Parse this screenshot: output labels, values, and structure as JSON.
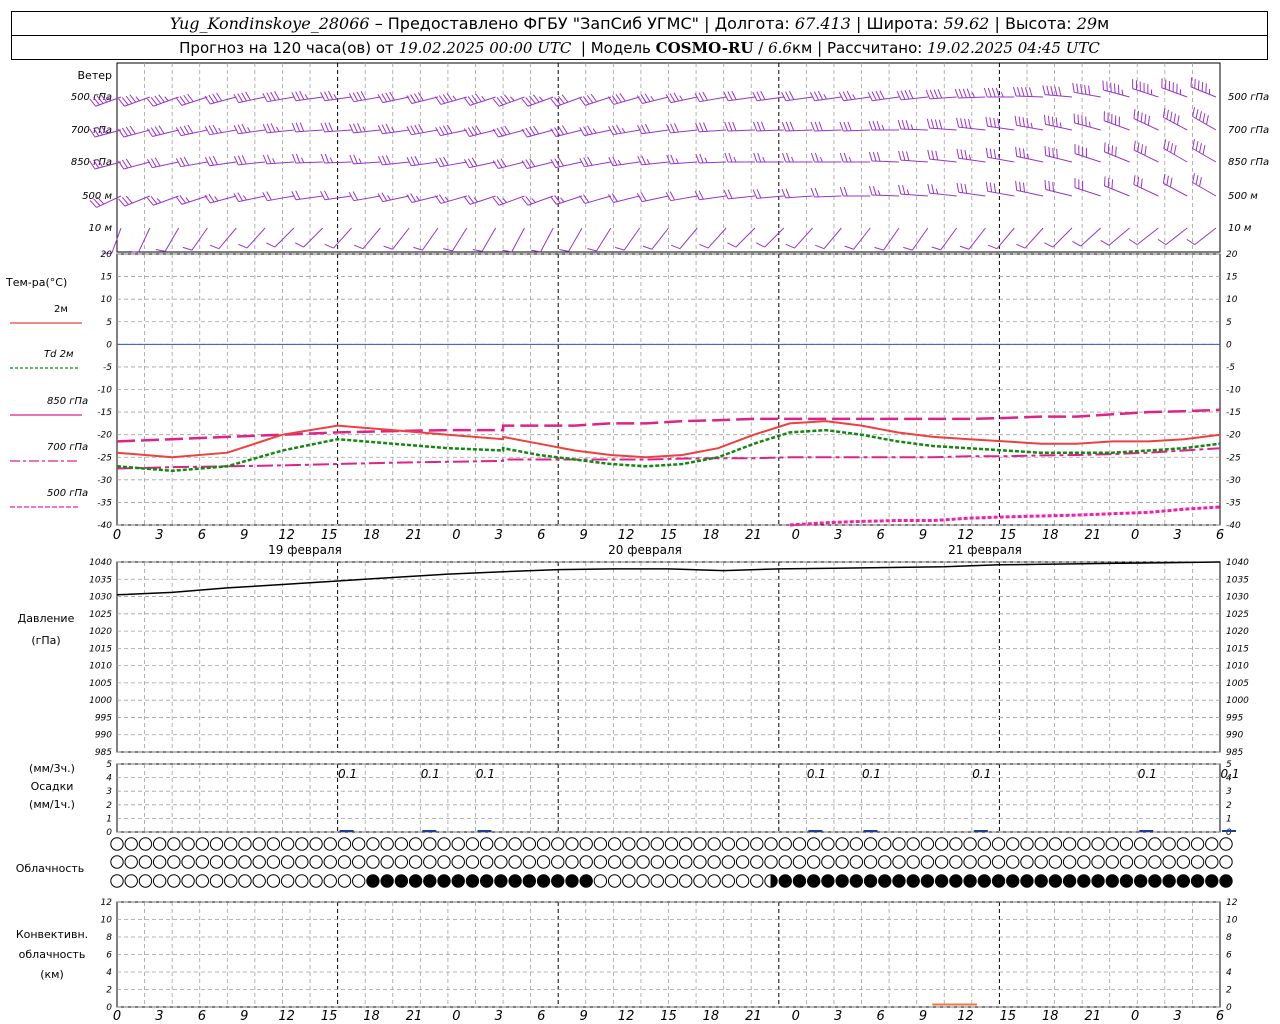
{
  "header": {
    "station": "Yug_Kondinskoye_28066",
    "provider": "– Предоставлено ФГБУ \"ЗапСиб УГМС\"",
    "lon_label": "Долгота:",
    "lon_value": "67.413",
    "lat_label": "Широта:",
    "lat_value": "59.62",
    "alt_label": "Высота:",
    "alt_value": "29",
    "alt_unit": "м",
    "forecast_prefix": "Прогноз на 120 часа(ов) от",
    "forecast_start": "19.02.2025 00:00 UTC",
    "model_label": "Модель",
    "model_name": "COSMO-RU",
    "model_res": "6.6",
    "model_res_unit": "км",
    "calc_label": "Рассчитано:",
    "calc_time": "19.02.2025 04:45 UTC"
  },
  "chart_data": {
    "type": "meteogram",
    "x_hours": [
      0,
      120
    ],
    "x_ticks": [
      "0",
      "3",
      "6",
      "9",
      "12",
      "15",
      "18",
      "21",
      "0",
      "3",
      "6",
      "9",
      "12",
      "15",
      "18",
      "21",
      "0",
      "3",
      "6",
      "9",
      "12",
      "15",
      "18",
      "21",
      "0",
      "3",
      "6"
    ],
    "day_labels": [
      "19 февраля",
      "20 февраля",
      "21 февраля"
    ],
    "colors": {
      "wind": "#9933cc",
      "t2m": "#ee4040",
      "td2m": "#118811",
      "t850": "#dd2288",
      "t700": "#dd2288",
      "t500": "#ee22aa",
      "zero": "#3355cc",
      "pressure": "#000000",
      "precip": "#1f3c99",
      "convective": "#ee7744",
      "grid": "#a0a0a0"
    },
    "wind": {
      "title": "Ветер",
      "levels": [
        "500 гПа",
        "700 гПа",
        "850 гПа",
        "500 м",
        "10 м"
      ],
      "dir_deg": [
        [
          250,
          250,
          250,
          252,
          255,
          258,
          260,
          262,
          262,
          260,
          258,
          256,
          254,
          252,
          250,
          250,
          250,
          252,
          254,
          256,
          258,
          260,
          262,
          262,
          262,
          262,
          262,
          262,
          264,
          266,
          268,
          270,
          272,
          275,
          280,
          285,
          288,
          290,
          292
        ],
        [
          255,
          255,
          256,
          258,
          260,
          262,
          264,
          266,
          266,
          264,
          262,
          260,
          258,
          256,
          255,
          255,
          256,
          258,
          260,
          262,
          264,
          266,
          268,
          268,
          268,
          268,
          268,
          270,
          272,
          274,
          276,
          278,
          280,
          282,
          285,
          290,
          295,
          298,
          300
        ],
        [
          255,
          255,
          258,
          260,
          262,
          264,
          266,
          268,
          268,
          266,
          264,
          262,
          260,
          258,
          256,
          256,
          258,
          260,
          262,
          264,
          266,
          268,
          270,
          270,
          270,
          270,
          270,
          272,
          274,
          276,
          278,
          280,
          282,
          284,
          288,
          292,
          296,
          300,
          300
        ],
        [
          245,
          248,
          250,
          252,
          255,
          258,
          260,
          262,
          262,
          260,
          258,
          256,
          254,
          252,
          250,
          250,
          252,
          254,
          256,
          258,
          260,
          262,
          264,
          265,
          266,
          268,
          270,
          272,
          274,
          276,
          278,
          280,
          282,
          284,
          288,
          292,
          295,
          298,
          300
        ],
        [
          200,
          205,
          210,
          215,
          220,
          222,
          225,
          225,
          222,
          220,
          218,
          215,
          212,
          210,
          208,
          208,
          210,
          212,
          215,
          218,
          220,
          222,
          225,
          225,
          222,
          220,
          218,
          215,
          215,
          216,
          218,
          220,
          222,
          225,
          228,
          230,
          232,
          232,
          232
        ]
      ],
      "speed_ms": [
        [
          22,
          22,
          22,
          21,
          20,
          20,
          19,
          18,
          18,
          19,
          20,
          21,
          22,
          22,
          22,
          22,
          21,
          20,
          19,
          18,
          17,
          16,
          16,
          16,
          16,
          17,
          18,
          19,
          20,
          21,
          22,
          23,
          24,
          25,
          26,
          27,
          28,
          28,
          28
        ],
        [
          20,
          20,
          19,
          19,
          18,
          18,
          17,
          16,
          16,
          17,
          18,
          19,
          20,
          20,
          20,
          20,
          19,
          18,
          17,
          16,
          15,
          15,
          15,
          15,
          15,
          16,
          16,
          17,
          18,
          19,
          20,
          21,
          22,
          22,
          23,
          24,
          24,
          24,
          24
        ],
        [
          16,
          16,
          15,
          15,
          14,
          14,
          13,
          12,
          12,
          13,
          14,
          15,
          16,
          16,
          16,
          16,
          15,
          14,
          13,
          12,
          12,
          12,
          12,
          12,
          12,
          13,
          13,
          14,
          15,
          16,
          17,
          18,
          18,
          19,
          20,
          20,
          20,
          20,
          20
        ],
        [
          14,
          14,
          13,
          13,
          12,
          12,
          11,
          10,
          10,
          11,
          12,
          12,
          13,
          13,
          13,
          13,
          12,
          11,
          10,
          10,
          10,
          10,
          10,
          10,
          10,
          11,
          11,
          12,
          12,
          13,
          14,
          14,
          15,
          15,
          16,
          16,
          16,
          16,
          16
        ],
        [
          5,
          6,
          6,
          5,
          5,
          4,
          4,
          4,
          4,
          4,
          4,
          4,
          5,
          5,
          5,
          5,
          4,
          4,
          4,
          4,
          4,
          4,
          4,
          4,
          4,
          4,
          4,
          4,
          4,
          4,
          4,
          5,
          5,
          5,
          5,
          5,
          5,
          5,
          5
        ]
      ]
    },
    "temperature": {
      "title": "Тем-ра(°C)",
      "ylim": [
        -40,
        20
      ],
      "y_ticks": [
        "20",
        "15",
        "10",
        "5",
        "0",
        "-5",
        "-10",
        "-15",
        "-20",
        "-25",
        "-30",
        "-35",
        "-40"
      ],
      "legend": [
        "2м",
        "Td 2м",
        "850 гПа",
        "700 гПа",
        "500 гПа"
      ],
      "hours": [
        0,
        6,
        12,
        18,
        24,
        30,
        36,
        42,
        48,
        54,
        60,
        66,
        72,
        78,
        84,
        90,
        96,
        102,
        108,
        114,
        120
      ],
      "t2m": [
        -24,
        -25,
        -24,
        -20,
        -18,
        -19,
        -20,
        -21,
        -21.5,
        -22,
        -22.5,
        -22,
        -20,
        -17.5,
        -17,
        -18.5,
        -20.5,
        -22,
        -23.5,
        -24.5,
        -25
      ],
      "td2m": [
        -27,
        -28,
        -27,
        -23.5,
        -21,
        -22,
        -23,
        -23.5,
        -24,
        -24.5,
        -25,
        -25,
        -23.5,
        -20.5,
        -19.5,
        -21,
        -23,
        -24.5,
        -25.5,
        -26.5,
        -27
      ],
      "t850": [
        -21.5,
        -21,
        -20.5,
        -20,
        -19.5,
        -19.2,
        -19,
        -19,
        -19,
        -19,
        -19,
        -18.5,
        -18,
        -18,
        -18,
        -18,
        -18,
        -18,
        -17.5,
        -17,
        -17
      ],
      "t700": [
        -27.5,
        -27.2,
        -27,
        -26.8,
        -26.5,
        -26.2,
        -26,
        -25.8,
        -25.5,
        -25.5,
        -25.5,
        -25.5,
        -25.5,
        -25.5,
        -25.5,
        -25.5,
        -25.5,
        -25.5,
        -25.5,
        -25.5,
        -25.5
      ],
      "t500": [
        null,
        null,
        null,
        null,
        null,
        null,
        null,
        null,
        null,
        null,
        null,
        null,
        null,
        null,
        null,
        null,
        -40,
        -40,
        -40,
        -40,
        -40
      ],
      "t2m_late": [
        -20.5,
        -22,
        -23.5,
        -24.5,
        -25,
        -24.5,
        -23,
        -20,
        -17.5,
        -17,
        -18,
        -19.5,
        -20.5,
        -21,
        -21.5,
        -22,
        -22,
        -21.5,
        -21.5,
        -21,
        -20
      ],
      "td2m_late": [
        -23,
        -24.5,
        -25.5,
        -26.5,
        -27,
        -26.5,
        -25,
        -22,
        -19.5,
        -19,
        -20,
        -21.5,
        -22.5,
        -23,
        -23.5,
        -24,
        -24,
        -24,
        -23.5,
        -23,
        -22
      ],
      "t850_late": [
        -18,
        -18,
        -18,
        -17.5,
        -17.5,
        -17,
        -16.8,
        -16.5,
        -16.5,
        -16.5,
        -16.5,
        -16.5,
        -16.5,
        -16.5,
        -16.3,
        -16,
        -16,
        -15.5,
        -15,
        -14.8,
        -14.5
      ],
      "t700_late": [
        -25.5,
        -25.5,
        -25.5,
        -25.5,
        -25.5,
        -25.3,
        -25.2,
        -25.2,
        -25,
        -25,
        -25,
        -25,
        -25,
        -24.8,
        -24.8,
        -24.6,
        -24.5,
        -24.3,
        -24,
        -23.5,
        -23
      ],
      "t500_late": [
        null,
        null,
        null,
        null,
        null,
        null,
        null,
        null,
        -40,
        -39.5,
        -39.2,
        -39,
        -39,
        -38.5,
        -38.2,
        -38,
        -37.8,
        -37.5,
        -37.2,
        -36.5,
        -36
      ]
    },
    "pressure": {
      "title": "Давление",
      "unit": "(гПа)",
      "ylim": [
        985,
        1040
      ],
      "y_ticks": [
        "1040",
        "1035",
        "1030",
        "1025",
        "1020",
        "1015",
        "1010",
        "1005",
        "1000",
        "995",
        "990",
        "985"
      ],
      "hours": [
        0,
        6,
        12,
        18,
        24,
        30,
        36,
        42,
        48,
        54,
        60,
        66,
        72,
        78,
        84,
        90,
        96,
        102,
        108,
        114,
        120
      ],
      "values": [
        1030.5,
        1031.2,
        1032.5,
        1033.5,
        1034.5,
        1035.5,
        1036.5,
        1037.2,
        1037.8,
        1038,
        1038,
        1037.5,
        1038,
        1038.2,
        1038.4,
        1038.6,
        1039.2,
        1039.4,
        1039.6,
        1039.8,
        1040
      ]
    },
    "precip": {
      "title": "Осадки",
      "unit_3h": "(мм/3ч.)",
      "unit_1h": "(мм/1ч.)",
      "ylim": [
        0,
        5
      ],
      "y_ticks": [
        "5",
        "4",
        "3",
        "2",
        "1",
        "0"
      ],
      "labels": [
        {
          "hour": 24,
          "text": "0.1"
        },
        {
          "hour": 33,
          "text": "0.1"
        },
        {
          "hour": 39,
          "text": "0.1"
        },
        {
          "hour": 75,
          "text": "0.1"
        },
        {
          "hour": 81,
          "text": "0.1"
        },
        {
          "hour": 93,
          "text": "0.1"
        },
        {
          "hour": 111,
          "text": "0.1"
        },
        {
          "hour": 120,
          "text": "0.1"
        }
      ]
    },
    "cloud": {
      "title": "Облачность",
      "count": 79,
      "rows": [
        {
          "level": "high",
          "filled": []
        },
        {
          "level": "middle",
          "filled": []
        },
        {
          "level": "low",
          "filled_ranges": [
            [
              18,
              33
            ],
            [
              47,
              78
            ]
          ],
          "half": [
            46
          ]
        }
      ]
    },
    "convective": {
      "title": [
        "Конвективн.",
        "облачность",
        "(км)"
      ],
      "ylim": [
        0,
        13
      ],
      "y_ticks": [
        "12",
        "10",
        "8",
        "6",
        "4",
        "2",
        "0"
      ],
      "bar": {
        "from_hour": 90,
        "to_hour": 94,
        "value_km": 0.2
      }
    }
  }
}
